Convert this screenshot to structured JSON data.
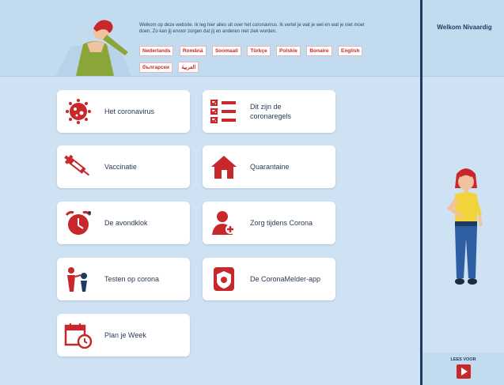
{
  "header": {
    "intro_text": "Welkom op deze website. Ik leg hier alles uit over het coronavirus. Ik vertel je wat je wel en wat je niet moet doen. Zo kan jij ervoor zorgen dat jij en anderen niet ziek worden.",
    "languages": [
      "Nederlands",
      "Română",
      "Soomaali",
      "Türkçe",
      "Polskie",
      "Bonaire",
      "English",
      "български",
      "العربية"
    ]
  },
  "right_panel": {
    "welcome_title": "Welkom Nivaardig",
    "read_label": "LEES VOOR"
  },
  "cards": [
    {
      "label": "Het coronavirus"
    },
    {
      "label": "Dit zijn de coronaregels"
    },
    {
      "label": "Vaccinatie"
    },
    {
      "label": "Quarantaine"
    },
    {
      "label": "De avondklok"
    },
    {
      "label": "Zorg tijdens Corona"
    },
    {
      "label": "Testen op corona"
    },
    {
      "label": "De CoronaMelder-app"
    },
    {
      "label": "Plan je Week"
    }
  ],
  "colors": {
    "accent": "#c8272c",
    "navy": "#1f3a5f",
    "bg": "#cfe2f3"
  }
}
